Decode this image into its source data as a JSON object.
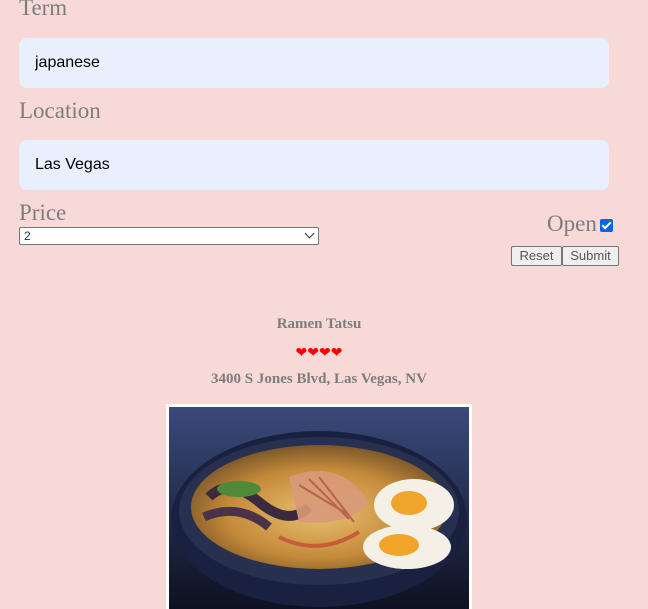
{
  "form": {
    "term_label": "Term",
    "term_value": "japanese",
    "location_label": "Location",
    "location_value": "Las Vegas",
    "price_label": "Price",
    "price_selected": "2",
    "open_label": "Open",
    "open_checked": true,
    "reset_label": "Reset",
    "submit_label": "Submit"
  },
  "result": {
    "name": "Ramen Tatsu",
    "rating_hearts": 4,
    "address": "3400 S Jones Blvd, Las Vegas, NV",
    "photo_icon": "ramen-bowl-photo"
  },
  "colors": {
    "background": "#f7dad7",
    "input_bg": "#e8f0fe",
    "label_text": "#7d7d7d",
    "heart": "#ff0000",
    "checkbox": "#0b63e5"
  }
}
